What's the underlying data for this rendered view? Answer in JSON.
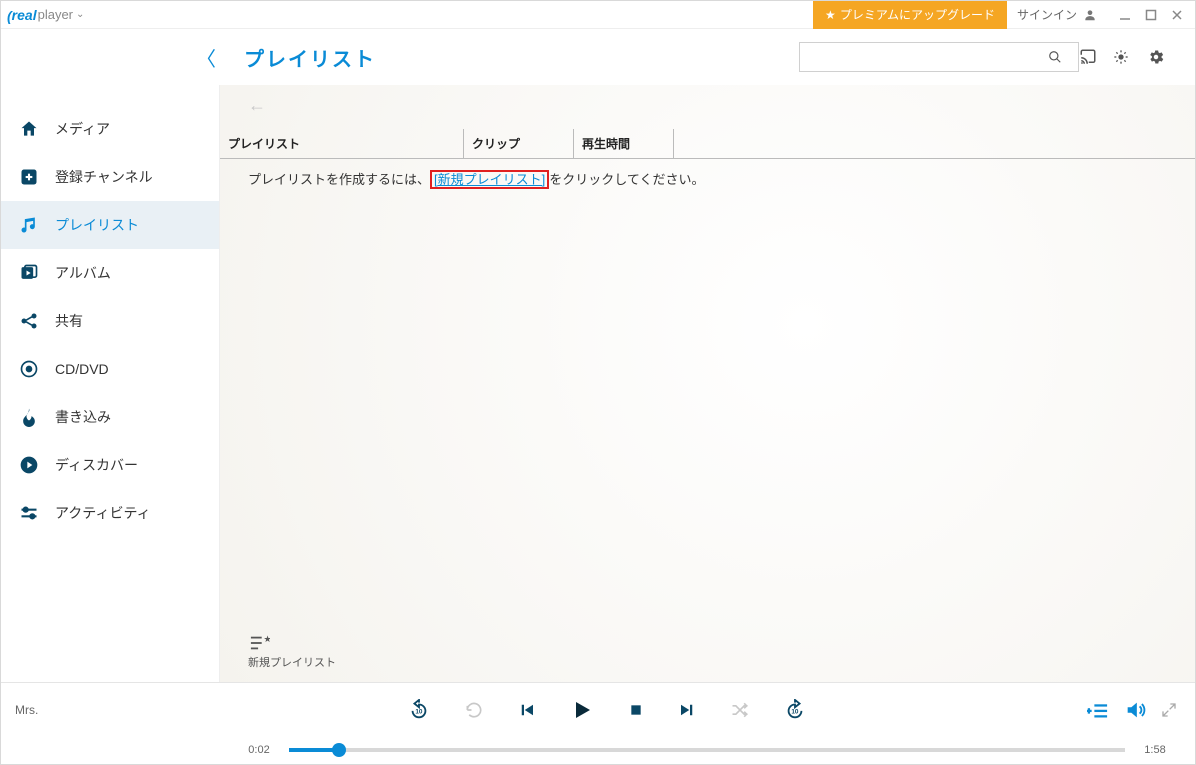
{
  "titlebar": {
    "logo_real": "real",
    "logo_player": "player",
    "upgrade": "プレミアムにアップグレード",
    "signin": "サインイン"
  },
  "header": {
    "title": "プレイリスト"
  },
  "sidebar": {
    "items": [
      {
        "label": "メディア"
      },
      {
        "label": "登録チャンネル"
      },
      {
        "label": "プレイリスト"
      },
      {
        "label": "アルバム"
      },
      {
        "label": "共有"
      },
      {
        "label": "CD/DVD"
      },
      {
        "label": "書き込み"
      },
      {
        "label": "ディスカバー"
      },
      {
        "label": "アクティビティ"
      }
    ]
  },
  "table": {
    "col1": "プレイリスト",
    "col2": "クリップ",
    "col3": "再生時間"
  },
  "empty": {
    "before": "プレイリストを作成するには、",
    "link": "[新規プレイリスト]",
    "after": "をクリックしてください。"
  },
  "bottom_tool": {
    "label": "新規プレイリスト"
  },
  "player": {
    "now_playing": "Mrs.",
    "time_current": "0:02",
    "time_total": "1:58"
  }
}
